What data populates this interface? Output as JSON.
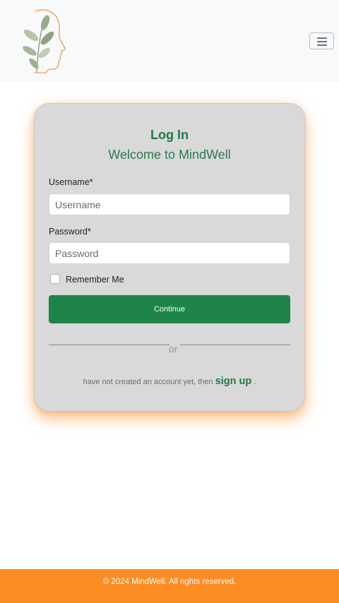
{
  "header": {
    "logo_icon": "face-silhouette-leaves-logo",
    "menu_icon": "hamburger-menu-icon"
  },
  "login": {
    "title": "Log In",
    "subtitle": "Welcome to MindWell",
    "username_label": "Username*",
    "username_placeholder": "Username",
    "username_value": "",
    "password_label": "Password*",
    "password_placeholder": "Password",
    "password_value": "",
    "remember_label": "Remember Me",
    "remember_checked": false,
    "continue_label": "Continue",
    "divider_text": "or",
    "signup_prefix": "have not created an account yet, then",
    "signup_link": "sign up",
    "signup_suffix": "."
  },
  "footer": {
    "copyright": "© 2024 MindWell. All rights reserved."
  },
  "colors": {
    "brand_green": "#1e8449",
    "accent_orange": "#fd8c25",
    "card_bg": "#d9d9d9"
  }
}
